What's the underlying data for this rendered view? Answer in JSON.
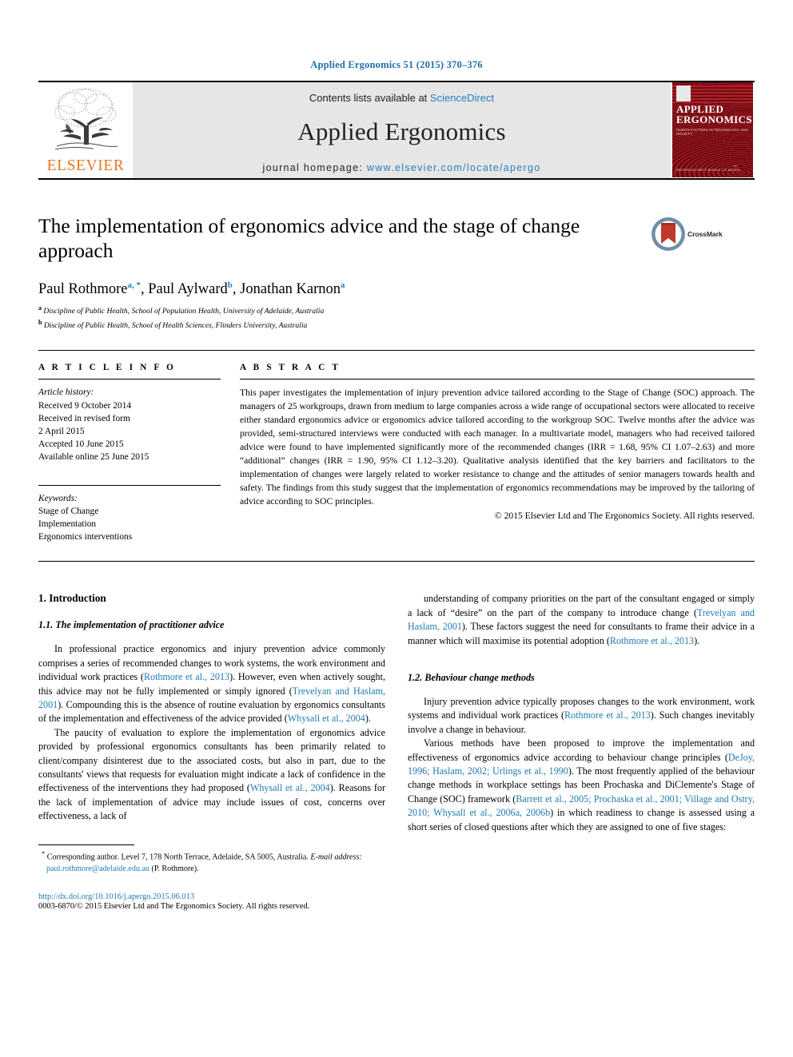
{
  "running_head": "Applied Ergonomics 51 (2015) 370–376",
  "header": {
    "contents_prefix": "Contents lists available at ",
    "sciencedirect": "ScienceDirect",
    "journal_name": "Applied Ergonomics",
    "homepage_prefix": "journal homepage: ",
    "homepage_url": "www.elsevier.com/locate/apergo",
    "publisher_logo_text": "ELSEVIER",
    "publisher_logo_icon": "elsevier-tree-icon",
    "cover": {
      "title_line1": "APPLIED",
      "title_line2": "ERGONOMICS",
      "subtitle": "HUMAN FACTORS IN TECHNOLOGY AND SOCIETY",
      "footer": "EDITORS-IN-CHIEF\nP. BUCKLE   J. R. WILSON"
    },
    "accent_link_color": "#2b7fbc",
    "brand_orange": "#e87722",
    "band_background": "#e6e6e6"
  },
  "article": {
    "title": "The implementation of ergonomics advice and the stage of change approach",
    "crossmark": {
      "label": "CrossMark",
      "icon": "crossmark-icon"
    },
    "authors": [
      {
        "name": "Paul Rothmore",
        "marks": "a, *"
      },
      {
        "name": "Paul Aylward",
        "marks": "b"
      },
      {
        "name": "Jonathan Karnon",
        "marks": "a"
      }
    ],
    "authors_line": "Paul Rothmore a, *, Paul Aylward b, Jonathan Karnon a",
    "affiliations": [
      {
        "mark": "a",
        "text": "Discipline of Public Health, School of Population Health, University of Adelaide, Australia"
      },
      {
        "mark": "b",
        "text": "Discipline of Public Health, School of Health Sciences, Flinders University, Australia"
      }
    ]
  },
  "article_info": {
    "heading": "A R T I C L E   I N F O",
    "history_label": "Article history:",
    "history": [
      "Received 9 October 2014",
      "Received in revised form",
      "2 April 2015",
      "Accepted 10 June 2015",
      "Available online 25 June 2015"
    ],
    "keywords_label": "Keywords:",
    "keywords": [
      "Stage of Change",
      "Implementation",
      "Ergonomics interventions"
    ]
  },
  "abstract": {
    "heading": "A B S T R A C T",
    "text": "This paper investigates the implementation of injury prevention advice tailored according to the Stage of Change (SOC) approach. The managers of 25 workgroups, drawn from medium to large companies across a wide range of occupational sectors were allocated to receive either standard ergonomics advice or ergonomics advice tailored according to the workgroup SOC. Twelve months after the advice was provided, semi-structured interviews were conducted with each manager. In a multivariate model, managers who had received tailored advice were found to have implemented significantly more of the recommended changes (IRR = 1.68, 95% CI 1.07–2.63) and more “additional” changes (IRR = 1.90, 95% CI 1.12–3.20). Qualitative analysis identified that the key barriers and facilitators to the implementation of changes were largely related to worker resistance to change and the attitudes of senior managers towards health and safety. The findings from this study suggest that the implementation of ergonomics recommendations may be improved by the tailoring of advice according to SOC principles.",
    "copyright": "© 2015 Elsevier Ltd and The Ergonomics Society. All rights reserved."
  },
  "body": {
    "section_1_heading": "1.  Introduction",
    "section_1_1_heading": "1.1.  The implementation of practitioner advice",
    "left_para_1_parts": [
      {
        "t": "In professional practice ergonomics and injury prevention advice commonly comprises a series of recommended changes to work systems, the work environment and individual work practices ("
      },
      {
        "t": "Rothmore et al., 2013",
        "cite": true
      },
      {
        "t": "). However, even when actively sought, this advice may not be fully implemented or simply ignored ("
      },
      {
        "t": "Trevelyan and Haslam, 2001",
        "cite": true
      },
      {
        "t": "). Compounding this is the absence of routine evaluation by ergonomics consultants of the implementation and effectiveness of the advice provided ("
      },
      {
        "t": "Whysall et al., 2004",
        "cite": true
      },
      {
        "t": ")."
      }
    ],
    "left_para_2_parts": [
      {
        "t": "The paucity of evaluation to explore the implementation of ergonomics advice provided by professional ergonomics consultants has been primarily related to client/company disinterest due to the associated costs, but also in part, due to the consultants' views that requests for evaluation might indicate a lack of confidence in the effectiveness of the interventions they had proposed ("
      },
      {
        "t": "Whysall et al., 2004",
        "cite": true
      },
      {
        "t": "). Reasons for the lack of implementation of advice may include issues of cost, concerns over effectiveness, a lack of"
      }
    ],
    "right_para_1_parts": [
      {
        "t": "understanding of company priorities on the part of the consultant engaged or simply a lack of “desire” on the part of the company to introduce change ("
      },
      {
        "t": "Trevelyan and Haslam, 2001",
        "cite": true
      },
      {
        "t": "). These factors suggest the need for consultants to frame their advice in a manner which will maximise its potential adoption ("
      },
      {
        "t": "Rothmore et al., 2013",
        "cite": true
      },
      {
        "t": ")."
      }
    ],
    "section_1_2_heading": "1.2.  Behaviour change methods",
    "right_para_2_parts": [
      {
        "t": "Injury prevention advice typically proposes changes to the work environment, work systems and individual work practices ("
      },
      {
        "t": "Rothmore et al., 2013",
        "cite": true
      },
      {
        "t": "). Such changes inevitably involve a change in behaviour."
      }
    ],
    "right_para_3_parts": [
      {
        "t": "Various methods have been proposed to improve the implementation and effectiveness of ergonomics advice according to behaviour change principles ("
      },
      {
        "t": "DeJoy, 1996; Haslam, 2002; Urlings et al., 1990",
        "cite": true
      },
      {
        "t": "). The most frequently applied of the behaviour change methods in workplace settings has been Prochaska and DiClemente's Stage of Change (SOC) framework ("
      },
      {
        "t": "Barrett et al., 2005; Prochaska et al., 2001; Village and Ostry, 2010; Whysall et al., 2006a, 2006b",
        "cite": true
      },
      {
        "t": ") in which readiness to change is assessed using a short series of closed questions after which they are assigned to one of five stages:"
      }
    ]
  },
  "footer": {
    "corresponding_marker": "*",
    "corresponding_text": "Corresponding author. Level 7, 178 North Terrace, Adelaide, SA 5005, Australia.",
    "email_label": "E-mail address:",
    "email": "paul.rothmore@adelaide.edu.au",
    "email_owner": "(P. Rothmore).",
    "doi": "http://dx.doi.org/10.1016/j.apergo.2015.06.013",
    "issn_line": "0003-6870/© 2015 Elsevier Ltd and The Ergonomics Society. All rights reserved."
  }
}
